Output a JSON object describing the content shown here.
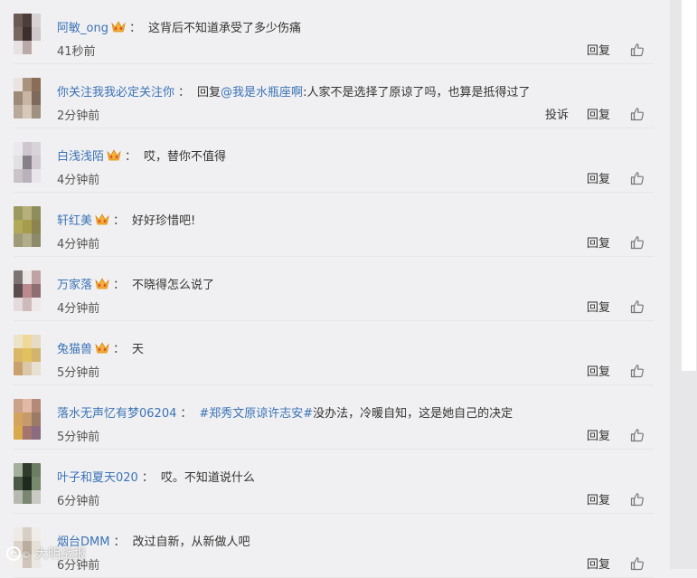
{
  "actions": {
    "reply_label": "回复",
    "report_label": "投诉"
  },
  "watermark": {
    "text": "大明战报"
  },
  "comments": [
    {
      "username": "阿敏_ong",
      "has_crown": true,
      "reply_to": null,
      "segments": [
        {
          "type": "text",
          "value": "这背后不知道承受了多少伤痛"
        }
      ],
      "time": "41秒前",
      "show_report": false,
      "avatar": [
        "#6d5a55",
        "#4b3d3a",
        "#d8d2d4",
        "#7a6661",
        "#3c2e2d",
        "#cfc9cc",
        "#e6e1e3",
        "#b9aaa8",
        "#f2eff0"
      ]
    },
    {
      "username": "你关注我我必定关注你",
      "has_crown": false,
      "segments": [
        {
          "type": "text",
          "value": "回复"
        },
        {
          "type": "mention",
          "value": "@我是水瓶座啊"
        },
        {
          "type": "text",
          "value": ":人家不是选择了原谅了吗，也算是抵得过了"
        }
      ],
      "time": "2分钟前",
      "show_report": true,
      "avatar": [
        "#e9e4df",
        "#a9937f",
        "#8a6d58",
        "#9e8a79",
        "#c9b5a2",
        "#7d6a5c",
        "#b8a99b",
        "#d6c8ba",
        "#a0907f"
      ]
    },
    {
      "username": "白浅浅陌",
      "has_crown": true,
      "segments": [
        {
          "type": "text",
          "value": "哎，替你不值得"
        }
      ],
      "time": "4分钟前",
      "show_report": false,
      "avatar": [
        "#ece9ee",
        "#cfc7cf",
        "#d8d2d9",
        "#e3e0e3",
        "#86808a",
        "#d2cbd2",
        "#c8c4c8",
        "#b9b1bc",
        "#e9e5ea"
      ]
    },
    {
      "username": "轩红美",
      "has_crown": true,
      "segments": [
        {
          "type": "text",
          "value": "好好珍惜吧!"
        }
      ],
      "time": "4分钟前",
      "show_report": false,
      "avatar": [
        "#9a9a60",
        "#b8b07a",
        "#8e8e5c",
        "#b3a95a",
        "#a69d4c",
        "#8b8350",
        "#9f9b78",
        "#b2ad8a",
        "#8c8a6a"
      ]
    },
    {
      "username": "万家落",
      "has_crown": true,
      "segments": [
        {
          "type": "text",
          "value": "不晓得怎么说了"
        }
      ],
      "time": "4分钟前",
      "show_report": false,
      "avatar": [
        "#7c7373",
        "#eae6e6",
        "#c0a2a4",
        "#5d4d4f",
        "#ba8a8c",
        "#8e6e70",
        "#e5dadb",
        "#cfbabb",
        "#efe8e9"
      ]
    },
    {
      "username": "兔猫兽",
      "has_crown": true,
      "segments": [
        {
          "type": "text",
          "value": "天"
        }
      ],
      "time": "5分钟前",
      "show_report": false,
      "avatar": [
        "#ece4c6",
        "#efd89a",
        "#e6dcc6",
        "#d9b766",
        "#e2c25e",
        "#d1b46e",
        "#c8a16e",
        "#dcc7a8",
        "#e8e0d0"
      ]
    },
    {
      "username": "落水无声忆有梦06204",
      "has_crown": false,
      "segments": [
        {
          "type": "hashtag",
          "value": "#郑秀文原谅许志安#"
        },
        {
          "type": "text",
          "value": "没办法，冷暖自知，这是她自己的决定"
        }
      ],
      "time": "5分钟前",
      "show_report": false,
      "avatar": [
        "#c9a289",
        "#e2b8a6",
        "#b38a78",
        "#d4a35e",
        "#c69a6a",
        "#9b7a66",
        "#d9a94d",
        "#a3756e",
        "#8a6b7f"
      ]
    },
    {
      "username": "叶子和夏天020",
      "has_crown": false,
      "segments": [
        {
          "type": "text",
          "value": "哎。不知道说什么"
        }
      ],
      "time": "6分钟前",
      "show_report": false,
      "avatar": [
        "#a5b09b",
        "#2f3b2d",
        "#6d7d63",
        "#4a5a46",
        "#1f2a1f",
        "#778a6c",
        "#b6b9b0",
        "#7a8672",
        "#c8cac3"
      ]
    },
    {
      "username": "烟台DMM",
      "has_crown": false,
      "segments": [
        {
          "type": "text",
          "value": "改过自新，从新做人吧"
        }
      ],
      "time": "6分钟前",
      "show_report": false,
      "avatar": [
        "#eeebe7",
        "#d7cfc6",
        "#f0ede9",
        "#dcd4cb",
        "#bcae9f",
        "#e6e0d9",
        "#f1eeeb",
        "#cfc5ba",
        "#ebe7e2"
      ]
    }
  ]
}
